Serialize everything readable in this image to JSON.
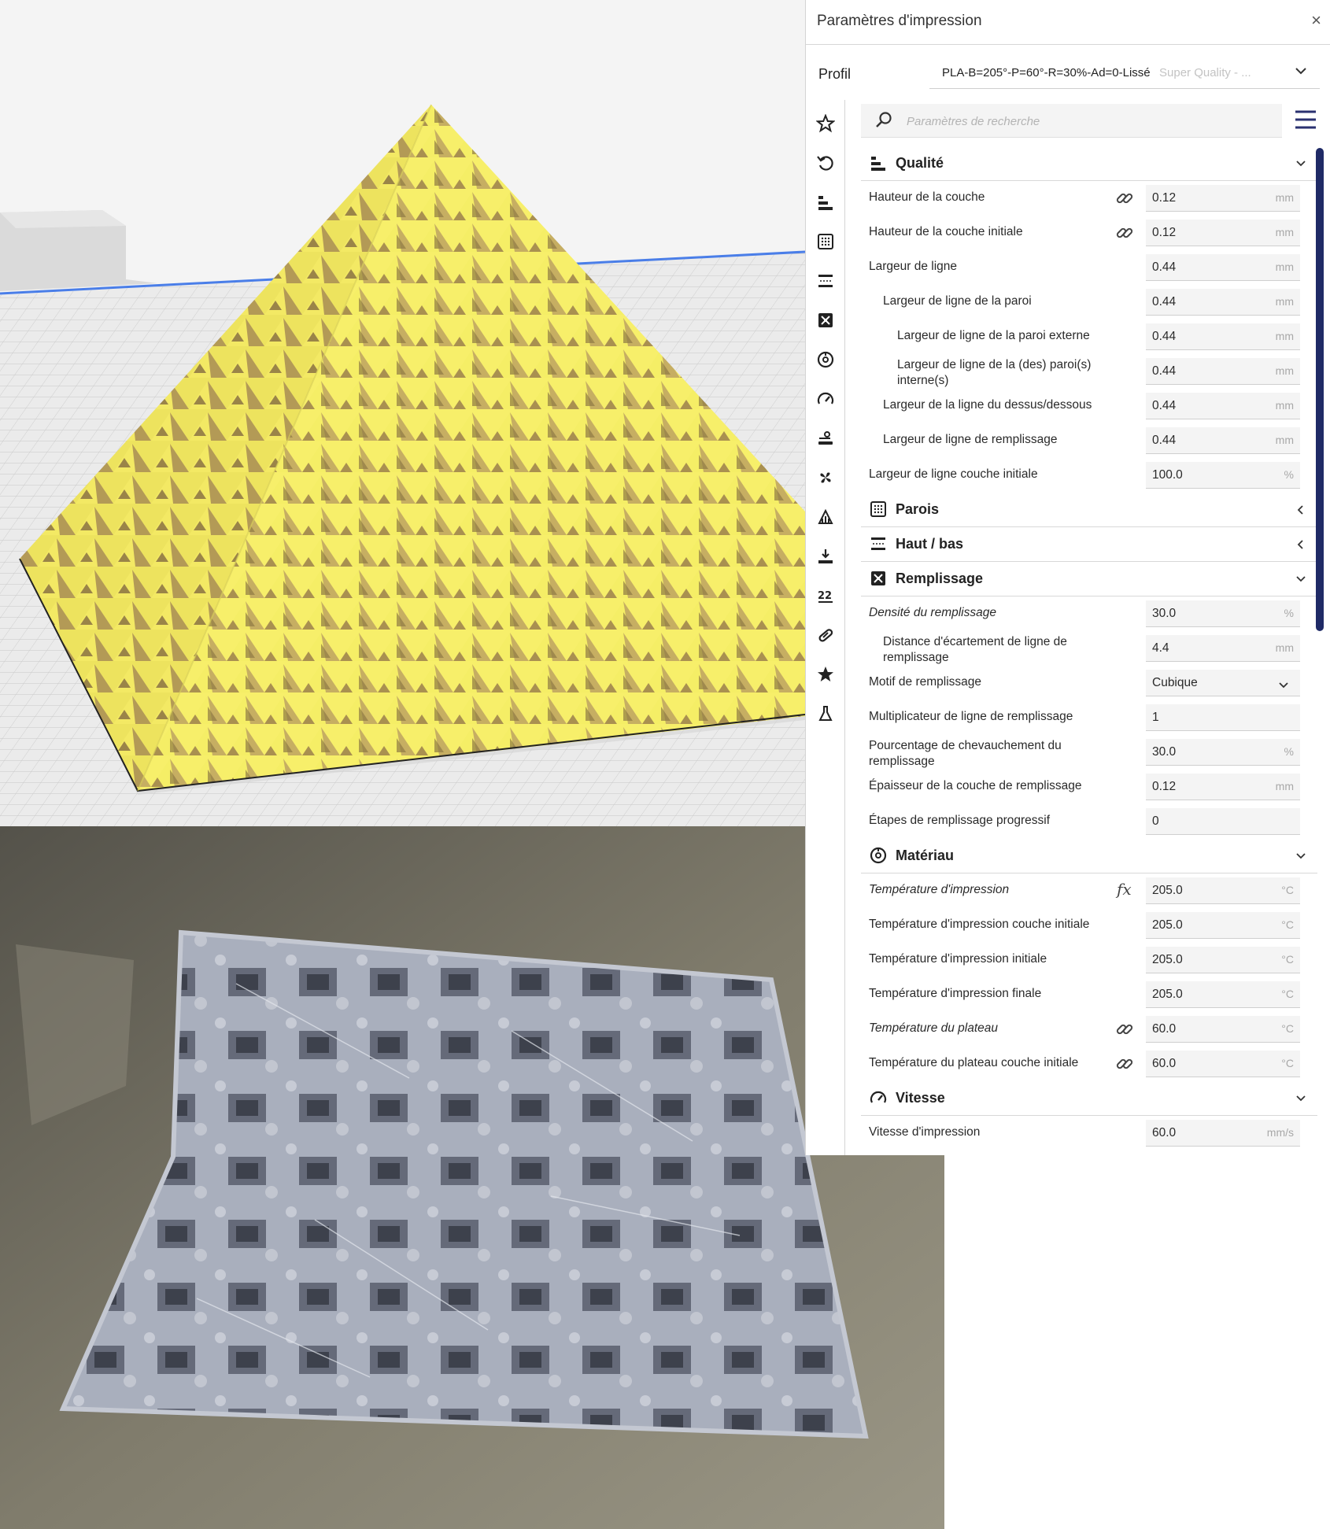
{
  "panel": {
    "title": "Paramètres d'impression",
    "close_symbol": "×",
    "profile_label": "Profil",
    "profile_name": "PLA-B=205°-P=60°-R=30%-Ad=0-Lissé",
    "profile_quality": "Super Quality - ...",
    "search_placeholder": "Paramètres de recherche"
  },
  "strip_icons": [
    "star-icon",
    "undo-icon",
    "quality-icon",
    "walls-icon",
    "top-bottom-icon",
    "infill-icon",
    "material-icon",
    "speed-icon",
    "travel-icon",
    "cooling-icon",
    "support-icon",
    "adhesion-icon",
    "dual-extrusion-icon",
    "mesh-fixes-icon",
    "special-modes-icon",
    "experimental-icon"
  ],
  "settings": [
    {
      "kind": "category",
      "label": "Qualité",
      "icon": "quality-icon",
      "expanded": true
    },
    {
      "kind": "setting",
      "label": "Hauteur de la couche",
      "value": "0.12",
      "unit": "mm",
      "indent": 0,
      "linked": true
    },
    {
      "kind": "setting",
      "label": "Hauteur de la couche initiale",
      "value": "0.12",
      "unit": "mm",
      "indent": 0,
      "linked": true
    },
    {
      "kind": "setting",
      "label": "Largeur de ligne",
      "value": "0.44",
      "unit": "mm",
      "indent": 0
    },
    {
      "kind": "setting",
      "label": "Largeur de ligne de la paroi",
      "value": "0.44",
      "unit": "mm",
      "indent": 1
    },
    {
      "kind": "setting",
      "label": "Largeur de ligne de la paroi externe",
      "value": "0.44",
      "unit": "mm",
      "indent": 2
    },
    {
      "kind": "setting",
      "label": "Largeur de ligne de la (des) paroi(s)\ninterne(s)",
      "value": "0.44",
      "unit": "mm",
      "indent": 2
    },
    {
      "kind": "setting",
      "label": "Largeur de la ligne du dessus/dessous",
      "value": "0.44",
      "unit": "mm",
      "indent": 1
    },
    {
      "kind": "setting",
      "label": "Largeur de ligne de remplissage",
      "value": "0.44",
      "unit": "mm",
      "indent": 1
    },
    {
      "kind": "setting",
      "label": "Largeur de ligne couche initiale",
      "value": "100.0",
      "unit": "%",
      "indent": 0
    },
    {
      "kind": "category",
      "label": "Parois",
      "icon": "walls-icon",
      "expanded": false
    },
    {
      "kind": "category",
      "label": "Haut / bas",
      "icon": "top-bottom-icon",
      "expanded": false
    },
    {
      "kind": "category",
      "label": "Remplissage",
      "icon": "infill-icon",
      "expanded": true
    },
    {
      "kind": "setting",
      "label": "Densité du remplissage",
      "value": "30.0",
      "unit": "%",
      "indent": 0,
      "italic": true
    },
    {
      "kind": "setting",
      "label": "Distance d'écartement de ligne de\nremplissage",
      "value": "4.4",
      "unit": "mm",
      "indent": 1
    },
    {
      "kind": "setting",
      "label": "Motif de remplissage",
      "value": "Cubique",
      "unit": "",
      "indent": 0,
      "dropdown": true
    },
    {
      "kind": "setting",
      "label": "Multiplicateur de ligne de remplissage",
      "value": "1",
      "unit": "",
      "indent": 0
    },
    {
      "kind": "setting",
      "label": "Pourcentage de chevauchement du\nremplissage",
      "value": "30.0",
      "unit": "%",
      "indent": 0
    },
    {
      "kind": "setting",
      "label": "Épaisseur de la couche de remplissage",
      "value": "0.12",
      "unit": "mm",
      "indent": 0
    },
    {
      "kind": "setting",
      "label": "Étapes de remplissage progressif",
      "value": "0",
      "unit": "",
      "indent": 0
    },
    {
      "kind": "category",
      "label": "Matériau",
      "icon": "material-icon",
      "expanded": true
    },
    {
      "kind": "setting",
      "label": "Température d'impression",
      "value": "205.0",
      "unit": "°C",
      "indent": 0,
      "italic": true,
      "fx": true
    },
    {
      "kind": "setting",
      "label": "Température d'impression couche initiale",
      "value": "205.0",
      "unit": "°C",
      "indent": 0
    },
    {
      "kind": "setting",
      "label": "Température d'impression initiale",
      "value": "205.0",
      "unit": "°C",
      "indent": 0
    },
    {
      "kind": "setting",
      "label": "Température d'impression finale",
      "value": "205.0",
      "unit": "°C",
      "indent": 0
    },
    {
      "kind": "setting",
      "label": "Température du plateau",
      "value": "60.0",
      "unit": "°C",
      "indent": 0,
      "italic": true,
      "linked": true
    },
    {
      "kind": "setting",
      "label": "Température du plateau couche initiale",
      "value": "60.0",
      "unit": "°C",
      "indent": 0,
      "linked": true
    },
    {
      "kind": "category",
      "label": "Vitesse",
      "icon": "speed-icon",
      "expanded": true
    },
    {
      "kind": "setting",
      "label": "Vitesse d'impression",
      "value": "60.0",
      "unit": "mm/s",
      "indent": 0
    }
  ],
  "colors": {
    "accent": "#1f2a66",
    "model_yellow": "#f7ef6a",
    "model_shadow": "#b9a060",
    "print_gray": "#a7adbb"
  }
}
